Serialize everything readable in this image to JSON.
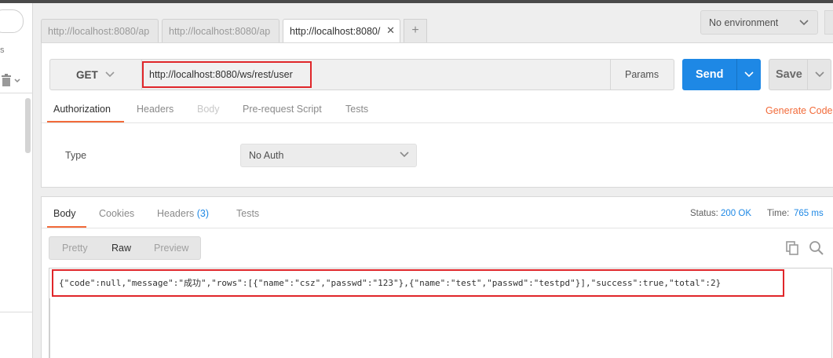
{
  "tabs": [
    {
      "label": "http://localhost:8080/ap"
    },
    {
      "label": "http://localhost:8080/ap"
    },
    {
      "label": "http://localhost:8080/",
      "close": "✕"
    }
  ],
  "tab_add": "+",
  "environment": {
    "selected": "No environment"
  },
  "sidebar": {
    "partial_letter": "s"
  },
  "request": {
    "method": "GET",
    "url": "http://localhost:8080/ws/rest/user",
    "params_label": "Params",
    "send_label": "Send",
    "save_label": "Save",
    "tabs": [
      "Authorization",
      "Headers",
      "Body",
      "Pre-request Script",
      "Tests"
    ],
    "generate_code": "Generate Code",
    "auth_type_label": "Type",
    "auth_type_value": "No Auth"
  },
  "response": {
    "tabs": {
      "body": "Body",
      "cookies": "Cookies",
      "headers": "Headers",
      "headers_count": "(3)",
      "tests": "Tests"
    },
    "status_label": "Status:",
    "status_value": "200 OK",
    "time_label": "Time:",
    "time_value": "765 ms",
    "view_modes": [
      "Pretty",
      "Raw",
      "Preview"
    ],
    "body": "{\"code\":null,\"message\":\"成功\",\"rows\":[{\"name\":\"csz\",\"passwd\":\"123\"},{\"name\":\"test\",\"passwd\":\"testpd\"}],\"success\":true,\"total\":2}"
  },
  "colors": {
    "accent": "#f26b3a",
    "send": "#1e88e5",
    "highlight": "#e0262a"
  }
}
